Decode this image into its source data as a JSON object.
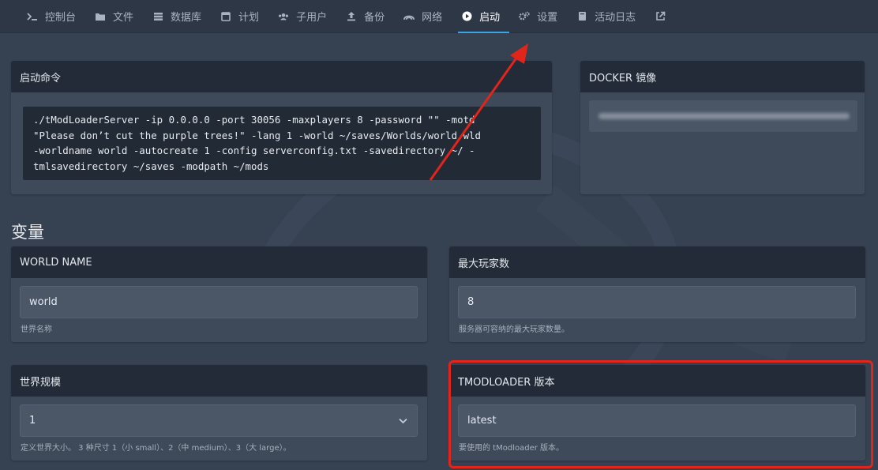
{
  "nav": {
    "items": [
      {
        "label": "控制台",
        "icon": "terminal-icon"
      },
      {
        "label": "文件",
        "icon": "folder-icon"
      },
      {
        "label": "数据库",
        "icon": "database-icon"
      },
      {
        "label": "计划",
        "icon": "calendar-icon"
      },
      {
        "label": "子用户",
        "icon": "users-icon"
      },
      {
        "label": "备份",
        "icon": "upload-icon"
      },
      {
        "label": "网络",
        "icon": "network-icon"
      },
      {
        "label": "启动",
        "icon": "play-icon",
        "active": true
      },
      {
        "label": "设置",
        "icon": "gears-icon"
      },
      {
        "label": "活动日志",
        "icon": "book-icon"
      },
      {
        "label": "",
        "icon": "external-link-icon"
      }
    ]
  },
  "startup": {
    "title": "启动命令",
    "command": "./tModLoaderServer -ip 0.0.0.0 -port 30056 -maxplayers 8 -password \"\" -motd\n\"Please don’t cut the purple trees!\" -lang 1 -world ~/saves/Worlds/world.wld\n-worldname world -autocreate 1 -config serverconfig.txt -savedirectory ~/ -\ntmlsavedirectory ~/saves -modpath ~/mods"
  },
  "docker": {
    "title": "DOCKER 镜像"
  },
  "variables": {
    "heading": "变量",
    "world_name": {
      "label": "WORLD NAME",
      "value": "world",
      "help": "世界名称"
    },
    "max_players": {
      "label": "最大玩家数",
      "value": "8",
      "help": "服务器可容纳的最大玩家数量。"
    },
    "world_size": {
      "label": "世界规模",
      "value": "1",
      "help": "定义世界大小。 3 种尺寸 1（小 small）、2（中 medium）、3（大 large）。"
    },
    "tmod_version": {
      "label": "TMODLOADER 版本",
      "value": "latest",
      "help": "要使用的 tModloader 版本。"
    }
  },
  "colors": {
    "accent": "#3aa3e3",
    "annotation": "#e1251b",
    "background": "#364152",
    "panel": "#3e4959",
    "panel_header": "#222b37"
  }
}
